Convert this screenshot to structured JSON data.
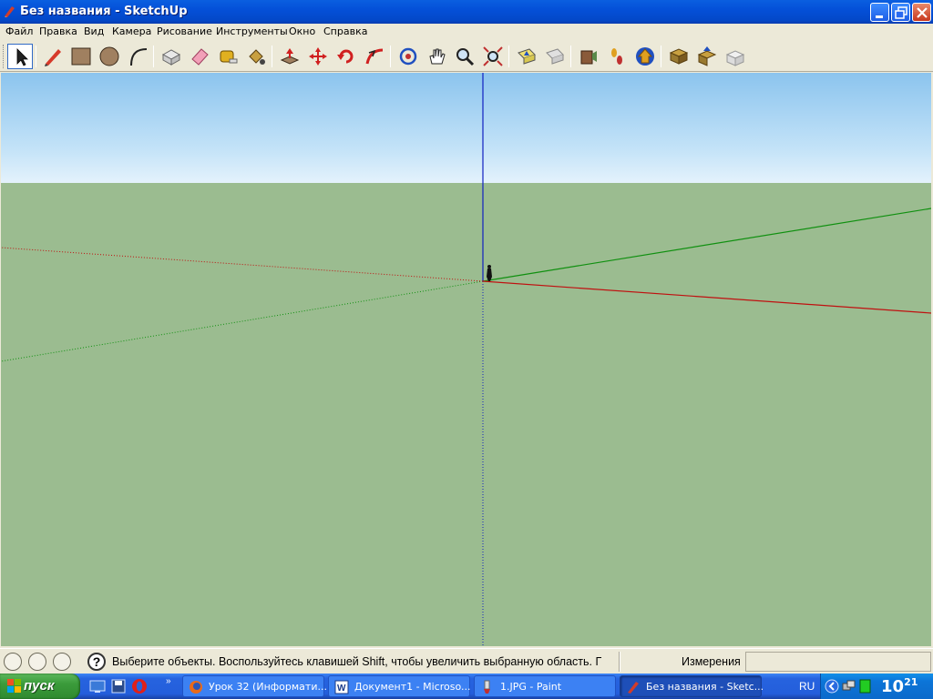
{
  "window": {
    "title": "Без названия - SketchUp"
  },
  "menubar": {
    "items": [
      "Файл",
      "Правка",
      "Вид",
      "Камера",
      "Рисование",
      "Инструменты",
      "Окно",
      "Справка"
    ]
  },
  "toolbar": {
    "tools": [
      "select-tool",
      "pencil-tool",
      "rectangle-tool",
      "circle-tool",
      "arc-tool",
      "make-component-tool",
      "eraser-tool",
      "tape-measure-tool",
      "paint-bucket-tool",
      "push-pull-tool",
      "move-tool",
      "rotate-tool",
      "follow-me-tool",
      "orbit-tool",
      "pan-tool",
      "zoom-tool",
      "zoom-extents-tool",
      "previous-view-tool",
      "next-view-tool",
      "position-camera-tool",
      "walk-tool",
      "look-around-tool",
      "get-models-tool",
      "share-model-tool",
      "share-component-tool"
    ],
    "active_tool": "select-tool"
  },
  "viewport": {
    "colors": {
      "sky": "#A9D4F4",
      "ground": "#9BBC90",
      "red_axis": "#C00000",
      "green_axis": "#00A000",
      "blue_axis": "#0000C0"
    }
  },
  "statusbar": {
    "message": "Выберите объекты. Воспользуйтесь клавишей Shift, чтобы увеличить выбранную область. Г",
    "measurements_label": "Измерения",
    "measurements_value": ""
  },
  "taskbar": {
    "start_label": "пуск",
    "tasks": [
      {
        "label": "Урок 32 (Информати...",
        "icon": "firefox-icon"
      },
      {
        "label": "Документ1 - Microso...",
        "icon": "word-icon"
      },
      {
        "label": "1.JPG - Paint",
        "icon": "paint-icon"
      },
      {
        "label": "Без названия - Sketc...",
        "icon": "sketchup-icon",
        "active": true
      }
    ],
    "language": "RU",
    "clock_hour": "10",
    "clock_minute": "21"
  }
}
